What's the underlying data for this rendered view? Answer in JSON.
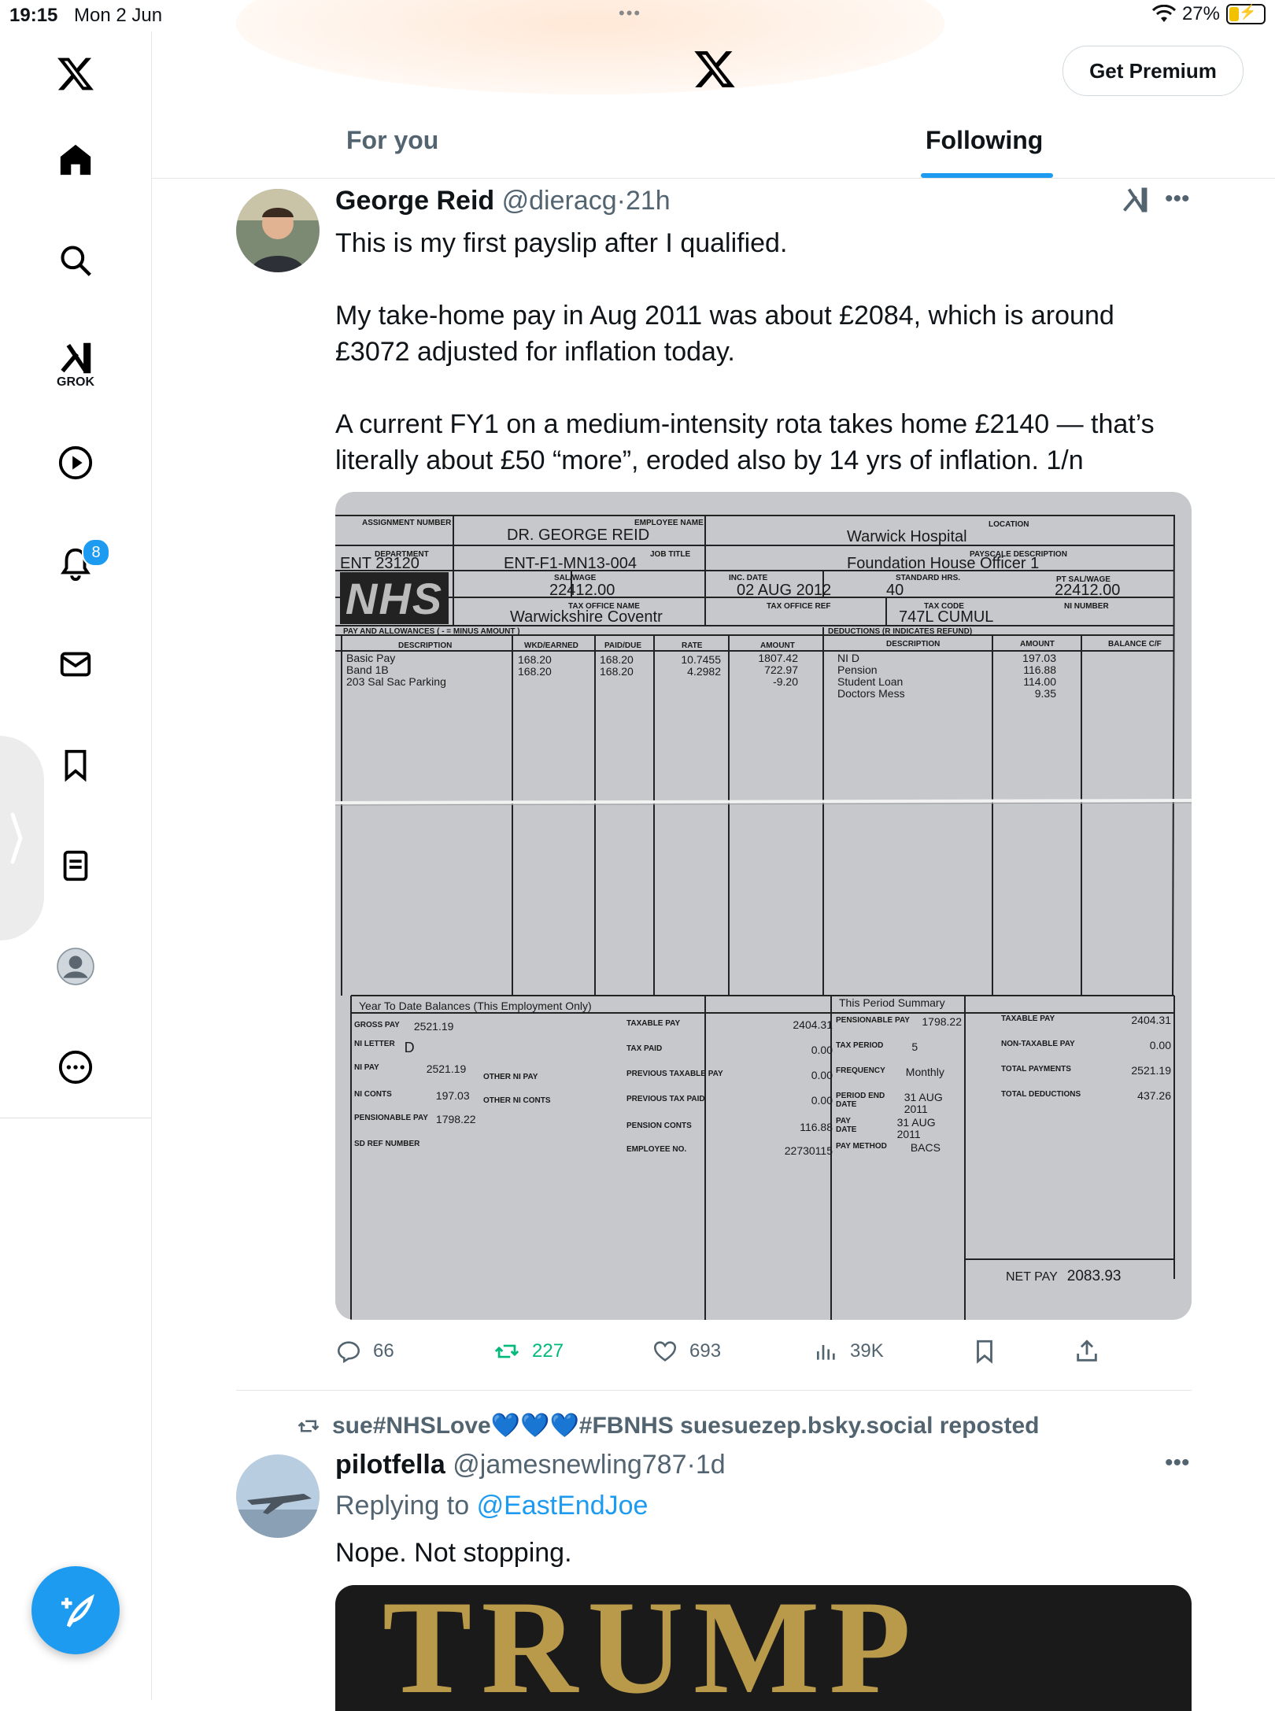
{
  "status_bar": {
    "time": "19:15",
    "date": "Mon 2 Jun",
    "battery": "27%"
  },
  "sidebar": {
    "grok_label": "GROK",
    "notification_count": "8"
  },
  "header": {
    "premium_label": "Get Premium",
    "tabs": [
      {
        "label": "For you"
      },
      {
        "label": "Following"
      }
    ]
  },
  "tweet1": {
    "name": "George Reid",
    "handle": "@dieracg",
    "time": "21h",
    "paragraphs": [
      "This is my first payslip after I qualified.",
      "My take-home pay in Aug 2011 was about £2084, which is around £3072 adjusted for inflation today.",
      "A current FY1 on a medium-intensity rota takes home £2140 — that’s literally about £50 “more”, eroded also by 14 yrs of inflation. 1/n"
    ],
    "stats": {
      "replies": "66",
      "reposts": "227",
      "likes": "693",
      "views": "39K"
    }
  },
  "payslip": {
    "labels": {
      "assignment": "ASSIGNMENT NUMBER",
      "employee_name": "EMPLOYEE NAME",
      "location": "LOCATION",
      "department": "DEPARTMENT",
      "job_title": "JOB TITLE",
      "payscale": "PAYSCALE DESCRIPTION",
      "salwage": "SAL/WAGE",
      "inc_date": "INC. DATE",
      "standard_hrs": "STANDARD HRS.",
      "pt_salwage": "PT SAL/WAGE",
      "tax_office_name": "TAX OFFICE NAME",
      "tax_office_ref": "TAX OFFICE REF",
      "tax_code": "TAX CODE",
      "ni_number": "NI NUMBER",
      "pay_allowances": "PAY AND ALLOWANCES ( - = MINUS AMOUNT )",
      "deductions": "DEDUCTIONS (R INDICATES REFUND)",
      "description": "DESCRIPTION",
      "wkd_earned": "WKD/EARNED",
      "paid_due": "PAID/DUE",
      "rate": "RATE",
      "amount": "AMOUNT",
      "balance": "BALANCE C/F",
      "ytd": "Year To Date Balances (This Employment Only)",
      "summary": "This Period Summary"
    },
    "values": {
      "employee_name": "DR. GEORGE REID",
      "location": "Warwick Hospital",
      "department": "ENT 23120",
      "job_title": "ENT-F1-MN13-004",
      "payscale": "Foundation House Officer 1",
      "salwage": "22412.00",
      "inc_date": "02 AUG 2012",
      "standard_hrs": "40",
      "pt_salwage": "22412.00",
      "tax_office_name": "Warwickshire Coventr",
      "tax_code": "747L CUMUL",
      "logo": "NHS"
    },
    "pay_lines": {
      "description": [
        "Basic Pay",
        "Band 1B",
        "203 Sal Sac Parking"
      ],
      "wkd": [
        "168.20",
        "168.20"
      ],
      "paid": [
        "168.20",
        "168.20"
      ],
      "rate": [
        "10.7455",
        "4.2982"
      ],
      "amount": [
        "1807.42",
        "722.97",
        "-9.20"
      ]
    },
    "deductions": {
      "description": [
        "NI D",
        "Pension",
        "Student Loan",
        "Doctors Mess"
      ],
      "amount": [
        "197.03",
        "116.88",
        "114.00",
        "9.35"
      ]
    },
    "ytd": [
      {
        "label": "GROSS PAY",
        "value": "2521.19"
      },
      {
        "label": "NI LETTER",
        "value": "D"
      },
      {
        "label": "NI PAY",
        "value": "2521.19"
      },
      {
        "label": "NI CONTS",
        "value": "197.03"
      },
      {
        "label": "PENSIONABLE PAY",
        "value": "1798.22"
      },
      {
        "label": "SD REF NUMBER",
        "value": ""
      },
      {
        "label": "OTHER NI PAY",
        "value": ""
      },
      {
        "label": "OTHER NI CONTS",
        "value": ""
      }
    ],
    "ytd_mid": [
      {
        "label": "TAXABLE PAY",
        "value": "2404.31"
      },
      {
        "label": "TAX PAID",
        "value": "0.00"
      },
      {
        "label": "PREVIOUS TAXABLE PAY",
        "value": "0.00"
      },
      {
        "label": "PREVIOUS TAX PAID",
        "value": "0.00"
      },
      {
        "label": "PENSION CONTS",
        "value": "116.88"
      },
      {
        "label": "EMPLOYEE NO.",
        "value": "22730115"
      }
    ],
    "summary_left": [
      {
        "label": "PENSIONABLE PAY",
        "value": "1798.22"
      },
      {
        "label": "TAX PERIOD",
        "value": "5"
      },
      {
        "label": "FREQUENCY",
        "value": "Monthly"
      },
      {
        "label": "PERIOD END DATE",
        "value": "31 AUG 2011"
      },
      {
        "label": "PAY DATE",
        "value": "31 AUG 2011"
      },
      {
        "label": "PAY METHOD",
        "value": "BACS"
      }
    ],
    "summary_right": [
      {
        "label": "TAXABLE PAY",
        "value": "2404.31"
      },
      {
        "label": "NON-TAXABLE PAY",
        "value": "0.00"
      },
      {
        "label": "TOTAL PAYMENTS",
        "value": "2521.19"
      },
      {
        "label": "TOTAL DEDUCTIONS",
        "value": "437.26"
      }
    ],
    "net_pay": {
      "label": "NET PAY",
      "value": "2083.93"
    }
  },
  "tweet2": {
    "reposted_by": "sue#NHSLove💙💙💙#FBNHS suesuezep.bsky.social reposted",
    "name": "pilotfella",
    "handle": "@jamesnewling787",
    "time": "1d",
    "replying_prefix": "Replying to",
    "replying_to": "@EastEndJoe",
    "text": "Nope. Not stopping.",
    "media_text": "TRUMP"
  }
}
